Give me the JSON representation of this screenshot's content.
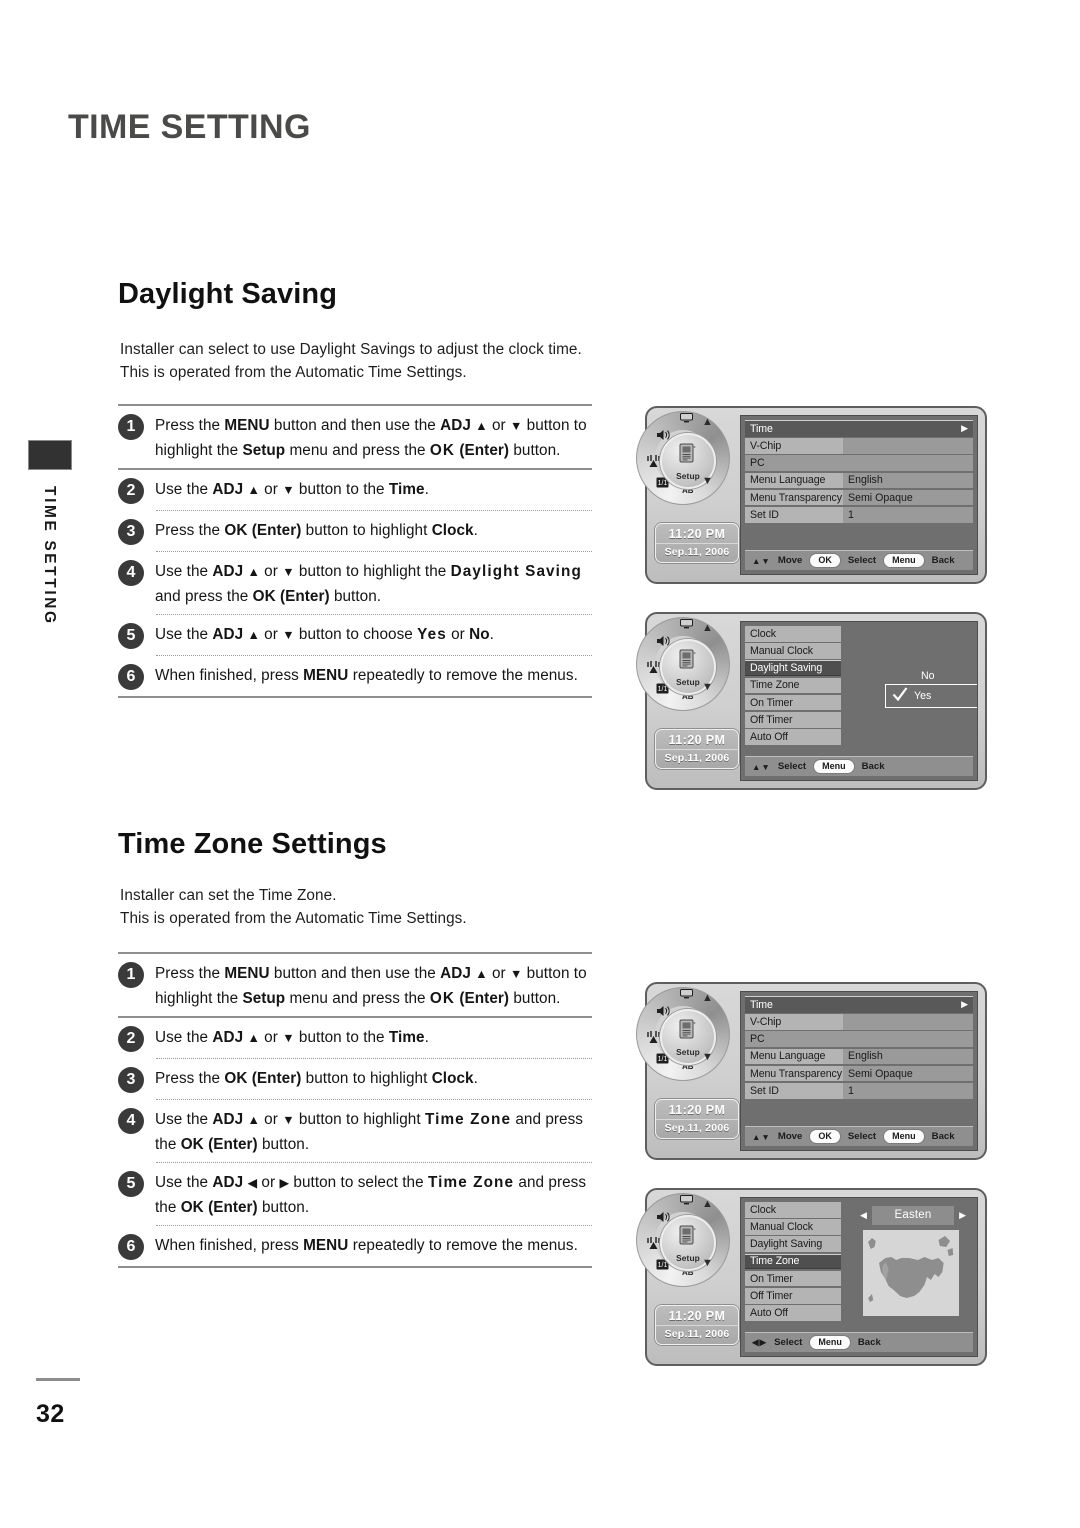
{
  "page": {
    "header_title": "TIME SETTING",
    "side_tab_label": "TIME SETTING",
    "page_number": "32"
  },
  "sections": [
    {
      "title": "Daylight Saving",
      "description_line1": "Installer can select to use Daylight Savings to adjust the clock time.",
      "description_line2": "This is operated from the Automatic Time Settings.",
      "steps": [
        {
          "num": "1",
          "text_html": "Press the <b>MENU</b> button and then use the <b>ADJ</b> <span class=\"arw\">▲</span> or <span class=\"arw\">▼</span> button to highlight the <b>Setup</b> menu and press the <b class=\"sp\">OK</b> <b>(Enter)</b> button."
        },
        {
          "num": "2",
          "text_html": "Use the <b>ADJ</b> <span class=\"arw\">▲</span> or <span class=\"arw\">▼</span> button to the <b>Time</b>."
        },
        {
          "num": "3",
          "text_html": "Press the <b>OK (Enter)</b> button to highlight <b>Clock</b>."
        },
        {
          "num": "4",
          "text_html": "Use the <b>ADJ</b> <span class=\"arw\">▲</span> or <span class=\"arw\">▼</span> button to highlight the <b class=\"sp\">Daylight Saving</b> and press the <b>OK (Enter)</b> button."
        },
        {
          "num": "5",
          "text_html": "Use the <b>ADJ</b> <span class=\"arw\">▲</span> or <span class=\"arw\">▼</span> button to choose <b class=\"sp\">Yes</b> or <b>No</b>."
        },
        {
          "num": "6",
          "text_html": "When finished, press <b>MENU</b> repeatedly to remove the menus."
        }
      ]
    },
    {
      "title": "Time Zone Settings",
      "description_line1": "Installer can set the Time Zone.",
      "description_line2": "This is operated from the Automatic Time Settings.",
      "steps": [
        {
          "num": "1",
          "text_html": "Press the <b>MENU</b> button and then use the <b>ADJ</b> <span class=\"arw\">▲</span> or <span class=\"arw\">▼</span> button to highlight the <b>Setup</b> menu and press the <b class=\"sp\">OK</b> <b>(Enter)</b> button."
        },
        {
          "num": "2",
          "text_html": "Use the <b>ADJ</b> <span class=\"arw\">▲</span> or <span class=\"arw\">▼</span> button to the <b>Time</b>."
        },
        {
          "num": "3",
          "text_html": "Press the <b>OK (Enter)</b> button to highlight <b>Clock</b>."
        },
        {
          "num": "4",
          "text_html": "Use the <b>ADJ</b> <span class=\"arw\">▲</span> or <span class=\"arw\">▼</span> button to highlight <b class=\"sp\">Time Zone</b> and press the <b>OK (Enter)</b> button."
        },
        {
          "num": "5",
          "text_html": "Use the <b>ADJ</b> <span class=\"arw\">◀</span> or <span class=\"arw\">▶</span> button to select the <b class=\"sp\">Time Zone</b> and press the <b>OK (Enter)</b> button."
        },
        {
          "num": "6",
          "text_html": "When finished, press <b>MENU</b> repeatedly to remove the menus."
        }
      ]
    }
  ],
  "tv_panel": {
    "hub_label": "Setup",
    "wheel_icons": [
      "monitor-icon",
      "speaker-icon",
      "antenna-icon",
      "tv-icon",
      "ab-icon"
    ],
    "nav_up": "▲",
    "nav_down": "▼",
    "clock_time": "11:20 PM",
    "clock_date": "Sep.11, 2006"
  },
  "screens": [
    {
      "id": "setup-menu-1",
      "type": "setup-list",
      "rows": [
        {
          "label": "Time",
          "value": "",
          "state": "highlight",
          "caret": "▶"
        },
        {
          "label": "V-Chip",
          "value": "",
          "state": "label-value"
        },
        {
          "label": "PC",
          "value": "",
          "state": "full"
        },
        {
          "label": "Menu Language",
          "value": "English",
          "state": "label-value"
        },
        {
          "label": "Menu Transparency",
          "value": "Semi Opaque",
          "state": "label-value"
        },
        {
          "label": "Set ID",
          "value": "1",
          "state": "label-value"
        }
      ],
      "bar": {
        "arrows": "▲▼",
        "arrows_label": "Move",
        "ok": "OK",
        "ok_label": "Select",
        "menu": "Menu",
        "menu_label": "Back"
      }
    },
    {
      "id": "clock-daylight-saving",
      "type": "clock-list",
      "items": [
        {
          "label": "Clock",
          "selected": false
        },
        {
          "label": "Manual Clock",
          "selected": false
        },
        {
          "label": "Daylight Saving",
          "selected": true
        },
        {
          "label": "Time Zone",
          "selected": false
        },
        {
          "label": "On Timer",
          "selected": false
        },
        {
          "label": "Off Timer",
          "selected": false
        },
        {
          "label": "Auto Off",
          "selected": false
        }
      ],
      "choice": {
        "option_no": "No",
        "option_yes": "Yes",
        "check": "✓"
      },
      "bar": {
        "arrows": "▲▼",
        "arrows_label": "Select",
        "menu": "Menu",
        "menu_label": "Back"
      }
    },
    {
      "id": "setup-menu-2",
      "type": "setup-list",
      "rows": [
        {
          "label": "Time",
          "value": "",
          "state": "highlight",
          "caret": "▶"
        },
        {
          "label": "V-Chip",
          "value": "",
          "state": "label-value"
        },
        {
          "label": "PC",
          "value": "",
          "state": "full"
        },
        {
          "label": "Menu Language",
          "value": "English",
          "state": "label-value"
        },
        {
          "label": "Menu Transparency",
          "value": "Semi Opaque",
          "state": "label-value"
        },
        {
          "label": "Set ID",
          "value": "1",
          "state": "label-value"
        }
      ],
      "bar": {
        "arrows": "▲▼",
        "arrows_label": "Move",
        "ok": "OK",
        "ok_label": "Select",
        "menu": "Menu",
        "menu_label": "Back"
      }
    },
    {
      "id": "clock-time-zone",
      "type": "clock-timezone",
      "items": [
        {
          "label": "Clock",
          "selected": false
        },
        {
          "label": "Manual Clock",
          "selected": false
        },
        {
          "label": "Daylight Saving",
          "selected": false
        },
        {
          "label": "Time Zone",
          "selected": true
        },
        {
          "label": "On Timer",
          "selected": false
        },
        {
          "label": "Off Timer",
          "selected": false
        },
        {
          "label": "Auto Off",
          "selected": false
        }
      ],
      "timezone": {
        "prev": "◀",
        "next": "▶",
        "name": "Easten"
      },
      "bar": {
        "arrows": "◀▶",
        "arrows_label": "Select",
        "menu": "Menu",
        "menu_label": "Back"
      }
    }
  ]
}
